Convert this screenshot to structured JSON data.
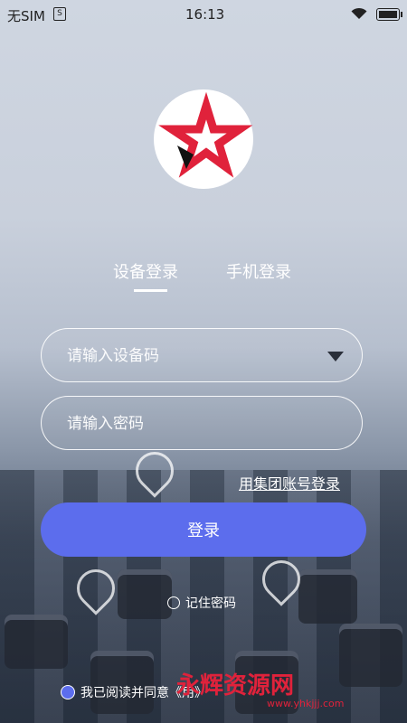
{
  "status_bar": {
    "carrier": "无SIM",
    "sim_icon": "sim-card-icon",
    "time": "16:13",
    "wifi_icon": "wifi-icon",
    "battery_icon": "battery-icon"
  },
  "logo": {
    "icon": "star-logo-icon",
    "colors": {
      "star": "#e0223b",
      "accent": "#111111"
    }
  },
  "tabs": [
    {
      "label": "设备登录",
      "active": true
    },
    {
      "label": "手机登录",
      "active": false
    }
  ],
  "form": {
    "device_placeholder": "请输入设备码",
    "password_placeholder": "请输入密码",
    "group_login_link": "用集团账号登录",
    "login_button": "登录",
    "remember_label": "记住密码",
    "agree_label": "我已阅读并同意《用",
    "agree_suffix": "》"
  },
  "watermark": {
    "text": "永辉资源网",
    "url": "www.yhkjjj.com"
  },
  "colors": {
    "primary": "#5c6ded",
    "watermark": "#e0223b"
  }
}
